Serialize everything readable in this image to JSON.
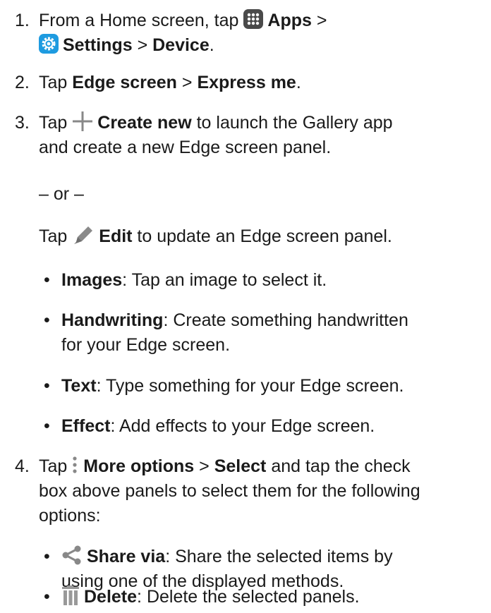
{
  "steps": [
    {
      "number": "1.",
      "line1_pre": "From a Home screen, tap ",
      "line1_bold": "Apps",
      "line1_post": " >",
      "line2_bold1": "Settings",
      "line2_mid": " > ",
      "line2_bold2": "Device",
      "line2_post": "."
    },
    {
      "number": "2.",
      "pre": "Tap ",
      "bold1": "Edge screen",
      "mid": " > ",
      "bold2": "Express me",
      "post": "."
    },
    {
      "number": "3.",
      "pre": "Tap ",
      "bold": "Create new",
      "post_line1": " to launch the Gallery app",
      "line2": "and create a new Edge screen panel.",
      "or": "– or –",
      "edit_pre": "Tap ",
      "edit_bold": "Edit",
      "edit_post": " to update an Edge screen panel."
    },
    {
      "number": "4.",
      "pre": "Tap ",
      "bold1": "More options",
      "mid": " > ",
      "bold2": "Select",
      "post_line1": " and tap the check",
      "line2": "box above panels to select them for the following",
      "line3": "options:"
    }
  ],
  "bullets_step3": [
    {
      "bold": "Images",
      "text": ": Tap an image to select it.",
      "text2": ""
    },
    {
      "bold": "Handwriting",
      "text": ": Create something handwritten",
      "text2": "for your Edge screen."
    },
    {
      "bold": "Text",
      "text": ": Type something for your Edge screen.",
      "text2": ""
    },
    {
      "bold": "Effect",
      "text": ": Add effects to your Edge screen.",
      "text2": ""
    }
  ],
  "bullets_step4": [
    {
      "bold": "Share via",
      "text": ": Share the selected items by",
      "text2": "using one of the displayed methods.",
      "icon": "share-icon"
    },
    {
      "bold": "Delete",
      "text": ": Delete the selected panels.",
      "text2": "",
      "icon": "trash-icon"
    }
  ],
  "bullet_char": "•",
  "icons": {
    "apps": "apps-grid-icon",
    "settings": "settings-gear-icon",
    "create": "plus-icon",
    "edit": "pencil-icon",
    "more": "more-options-icon",
    "share": "share-icon",
    "delete": "trash-icon"
  },
  "colors": {
    "text": "#1a1a1a",
    "apps_icon_bg": "#4a4a4a",
    "settings_icon_bg": "#1e9be0",
    "accent_gray": "#888888",
    "trash_gray": "#999999"
  }
}
